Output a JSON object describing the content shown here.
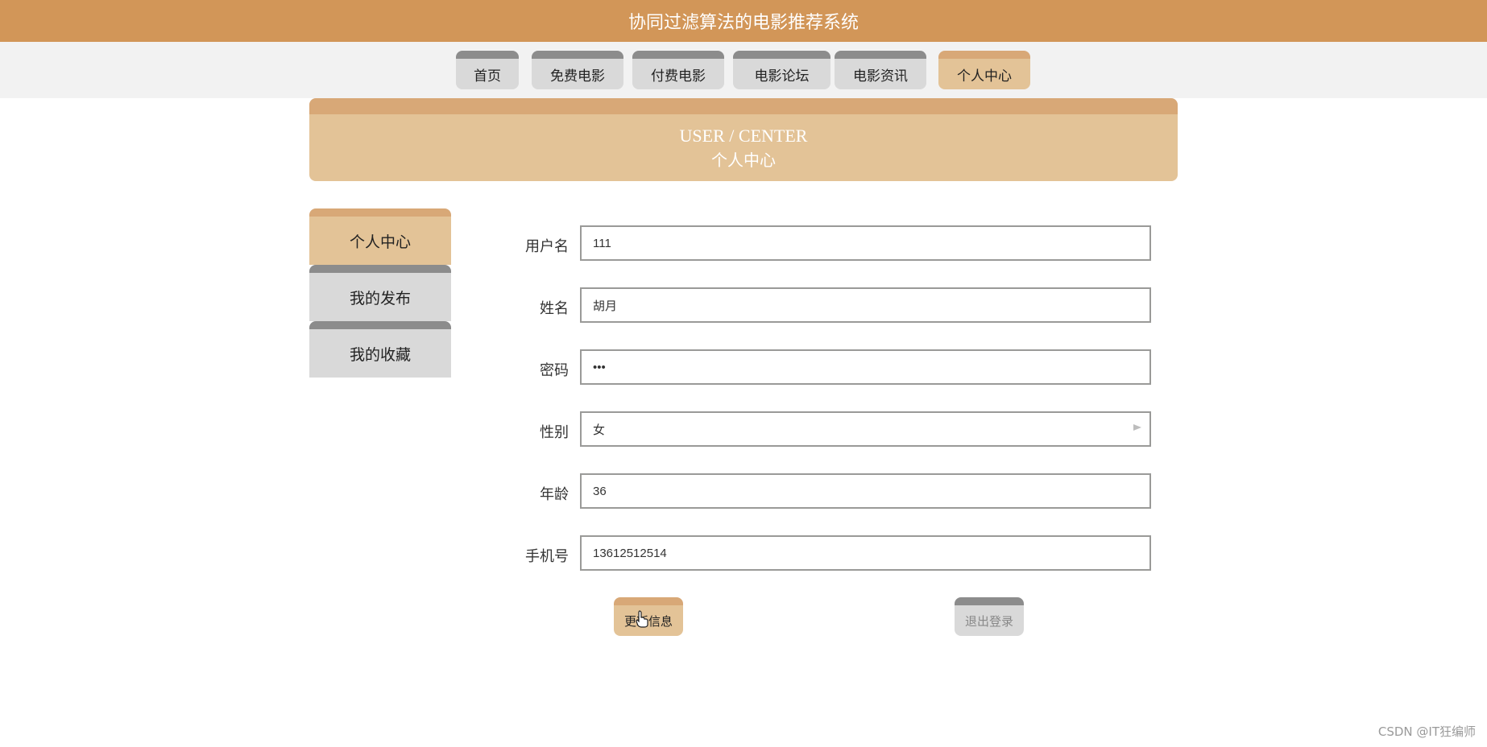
{
  "header": {
    "title": "协同过滤算法的电影推荐系统"
  },
  "nav": {
    "items": [
      {
        "label": "首页"
      },
      {
        "label": "免费电影"
      },
      {
        "label": "付费电影"
      },
      {
        "label": "电影论坛"
      },
      {
        "label": "电影资讯"
      },
      {
        "label": "个人中心",
        "active": true
      }
    ]
  },
  "banner": {
    "en": "USER / CENTER",
    "zh": "个人中心"
  },
  "sidebar": {
    "items": [
      {
        "label": "个人中心",
        "active": true
      },
      {
        "label": "我的发布"
      },
      {
        "label": "我的收藏"
      }
    ]
  },
  "form": {
    "username": {
      "label": "用户名",
      "value": "111"
    },
    "name": {
      "label": "姓名",
      "value": "胡月"
    },
    "password": {
      "label": "密码",
      "value": "111"
    },
    "gender": {
      "label": "性别",
      "value": "女"
    },
    "age": {
      "label": "年龄",
      "value": "36"
    },
    "phone": {
      "label": "手机号",
      "value": "13612512514"
    }
  },
  "buttons": {
    "update": "更新信息",
    "logout": "退出登录"
  },
  "watermark": "CSDN @IT狂编师",
  "colors": {
    "header": "#d29658",
    "active": "#e3c397",
    "accent_top": "#d8a877",
    "inactive": "#d9d9d9"
  }
}
